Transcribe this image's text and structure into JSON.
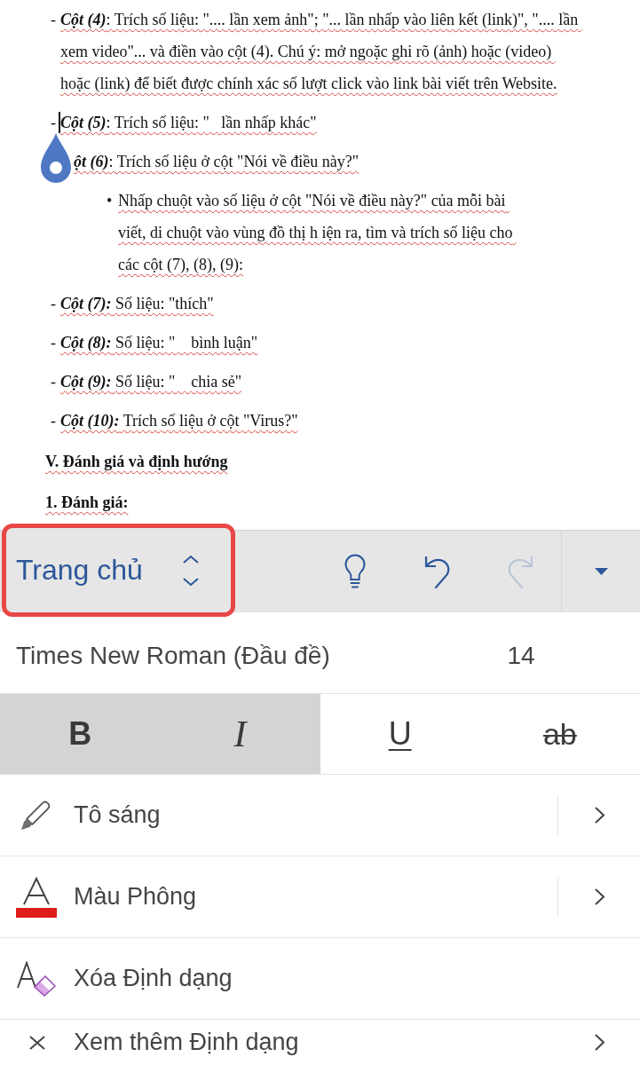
{
  "document": {
    "blocks": [
      {
        "kind": "dash_item",
        "dash": "-",
        "label": "Cột (4)",
        "text": ": Trích số liệu: \".... lần xem ảnh\"; \"... lần nhấp vào liên kết (link)\", \".... lần xem video\"... và điền vào cột (4). Chú ý: mở ngoặc ghi rõ (ảnh) hoặc (video) hoặc (link) để biết được chính xác số lượt click vào link bài viết trên Website.",
        "cursor": false
      },
      {
        "kind": "dash_item",
        "dash": "-",
        "label": "Cột (5)",
        "text": ": Trích số liệu: \"   lần nhấp khác\"",
        "cursor": true
      },
      {
        "kind": "dash_item",
        "label": "ột (6)",
        "text": ": Trích số liệu ở cột \"Nói về điều này?\"",
        "cursor": false
      },
      {
        "kind": "bullet_item",
        "bullet": "•",
        "text": "Nhấp chuột vào số liệu ở cột \"Nói về điều này?\" của mỗi bài viết, di chuột vào vùng đồ thị h iện ra, tìm và trích số liệu cho các cột (7), (8), (9):"
      },
      {
        "kind": "dash_item",
        "dash": "-",
        "label": "Cột (7):",
        "text": " Số liệu: \"thích\"",
        "cursor": false
      },
      {
        "kind": "dash_item",
        "dash": "-",
        "label": "Cột (8):",
        "text": " Số liệu: \"    bình luận\"",
        "cursor": false
      },
      {
        "kind": "dash_item",
        "dash": "-",
        "label": "Cột (9):",
        "text": " Số liệu: \"    chia sẻ\"",
        "cursor": false
      },
      {
        "kind": "dash_item",
        "dash": "-",
        "label": "Cột (10):",
        "text": " Trích số liệu ở cột \"Virus?\"",
        "cursor": false
      },
      {
        "kind": "heading",
        "text": "V. Đánh giá và định hướng"
      },
      {
        "kind": "heading",
        "text": "1. Đánh giá:"
      }
    ]
  },
  "toolbar": {
    "tab": {
      "label": "Trang chủ",
      "highlighted": true
    },
    "actions": [
      {
        "kind": "ideas",
        "disabled": false
      },
      {
        "kind": "undo",
        "disabled": false
      },
      {
        "kind": "redo",
        "disabled": true
      }
    ]
  },
  "font_row": {
    "font_name": "Times New Roman (Đầu đề)",
    "font_size": "14"
  },
  "format_buttons": [
    {
      "kind": "bold",
      "label": "B",
      "selected": true
    },
    {
      "kind": "italic",
      "label": "I",
      "selected": true
    },
    {
      "kind": "underline",
      "label": "U",
      "selected": false
    },
    {
      "kind": "strikethrough",
      "label": "ab",
      "selected": false
    }
  ],
  "menu": [
    {
      "kind": "highlight",
      "label": "Tô sáng",
      "split": true,
      "submenu": true
    },
    {
      "kind": "font_color",
      "label": "Màu Phông",
      "split": true,
      "submenu": true
    },
    {
      "kind": "clear_format",
      "label": "Xóa Định dạng",
      "split": false,
      "submenu": false
    },
    {
      "kind": "more_format",
      "label": "Xem thêm Định dạng",
      "split": false,
      "submenu": true
    }
  ]
}
